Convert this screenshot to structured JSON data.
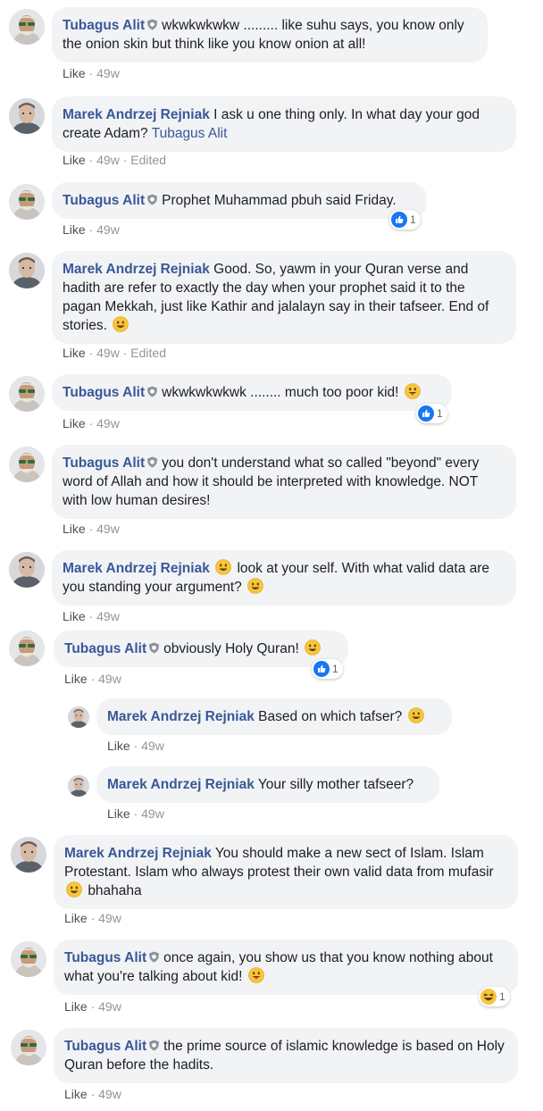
{
  "colors": {
    "author": "#385898",
    "bubble": "#f2f3f5",
    "meta": "#90949c",
    "like_blue": "#1877f2"
  },
  "comments": [
    {
      "author": "Tubagus Alit",
      "verified": true,
      "text": "wkwkwkwkw ......... like suhu says, you know only the onion skin but think like you know onion at all!",
      "like": "Like",
      "time": "49w"
    },
    {
      "author": "Marek Andrzej Rejniak",
      "verified": false,
      "text": "I ask u one thing only. In what day your god create Adam?",
      "mention": "Tubagus Alit",
      "like": "Like",
      "time": "49w",
      "edited": "Edited"
    },
    {
      "author": "Tubagus Alit",
      "verified": true,
      "text": "Prophet Muhammad pbuh said Friday.",
      "like": "Like",
      "time": "49w",
      "reaction_count": "1",
      "reaction_icon": "thumbs-up-icon"
    },
    {
      "author": "Marek Andrzej Rejniak",
      "verified": false,
      "text": "Good. So, yawm in your Quran verse and hadith are refer to exactly the day when your prophet said it to the pagan Mekkah, just like Kathir and jalalayn say in their tafseer. End of stories.",
      "like": "Like",
      "time": "49w",
      "edited": "Edited"
    },
    {
      "author": "Tubagus Alit",
      "verified": true,
      "text": "wkwkwkwkwk ........ much too poor kid!",
      "like": "Like",
      "time": "49w",
      "reaction_count": "1",
      "reaction_icon": "thumbs-up-icon"
    },
    {
      "author": "Tubagus Alit",
      "verified": true,
      "text": "you don't understand what so called \"beyond\" every word of Allah and how it should be interpreted with knowledge. NOT with low human desires!",
      "like": "Like",
      "time": "49w"
    },
    {
      "author": "Marek Andrzej Rejniak",
      "verified": false,
      "text_a": "look at your self. With what valid data are you standing your argument?",
      "like": "Like",
      "time": "49w"
    },
    {
      "author": "Tubagus Alit",
      "verified": true,
      "text": "obviously Holy Quran!",
      "like": "Like",
      "time": "49w",
      "reaction_count": "1",
      "reaction_icon": "thumbs-up-icon"
    },
    {
      "author": "Marek Andrzej Rejniak",
      "verified": false,
      "text": "Based on which tafser?",
      "like": "Like",
      "time": "49w"
    },
    {
      "author": "Marek Andrzej Rejniak",
      "verified": false,
      "text": "Your silly mother tafseer?",
      "like": "Like",
      "time": "49w"
    },
    {
      "author": "Marek Andrzej Rejniak",
      "verified": false,
      "text_a": "You should make a new sect of Islam. Islam Protestant. Islam who always protest their own valid data from mufasir",
      "text_b": "bhahaha",
      "like": "Like",
      "time": "49w"
    },
    {
      "author": "Tubagus Alit",
      "verified": true,
      "text": "once again, you show us that you know nothing about what you're talking about kid!",
      "like": "Like",
      "time": "49w",
      "reaction_count": "1",
      "reaction_icon": "laughing-emoji-icon"
    },
    {
      "author": "Tubagus Alit",
      "verified": true,
      "text": "the prime source of islamic knowledge is based on Holy Quran before the hadits.",
      "like": "Like",
      "time": "49w"
    }
  ]
}
